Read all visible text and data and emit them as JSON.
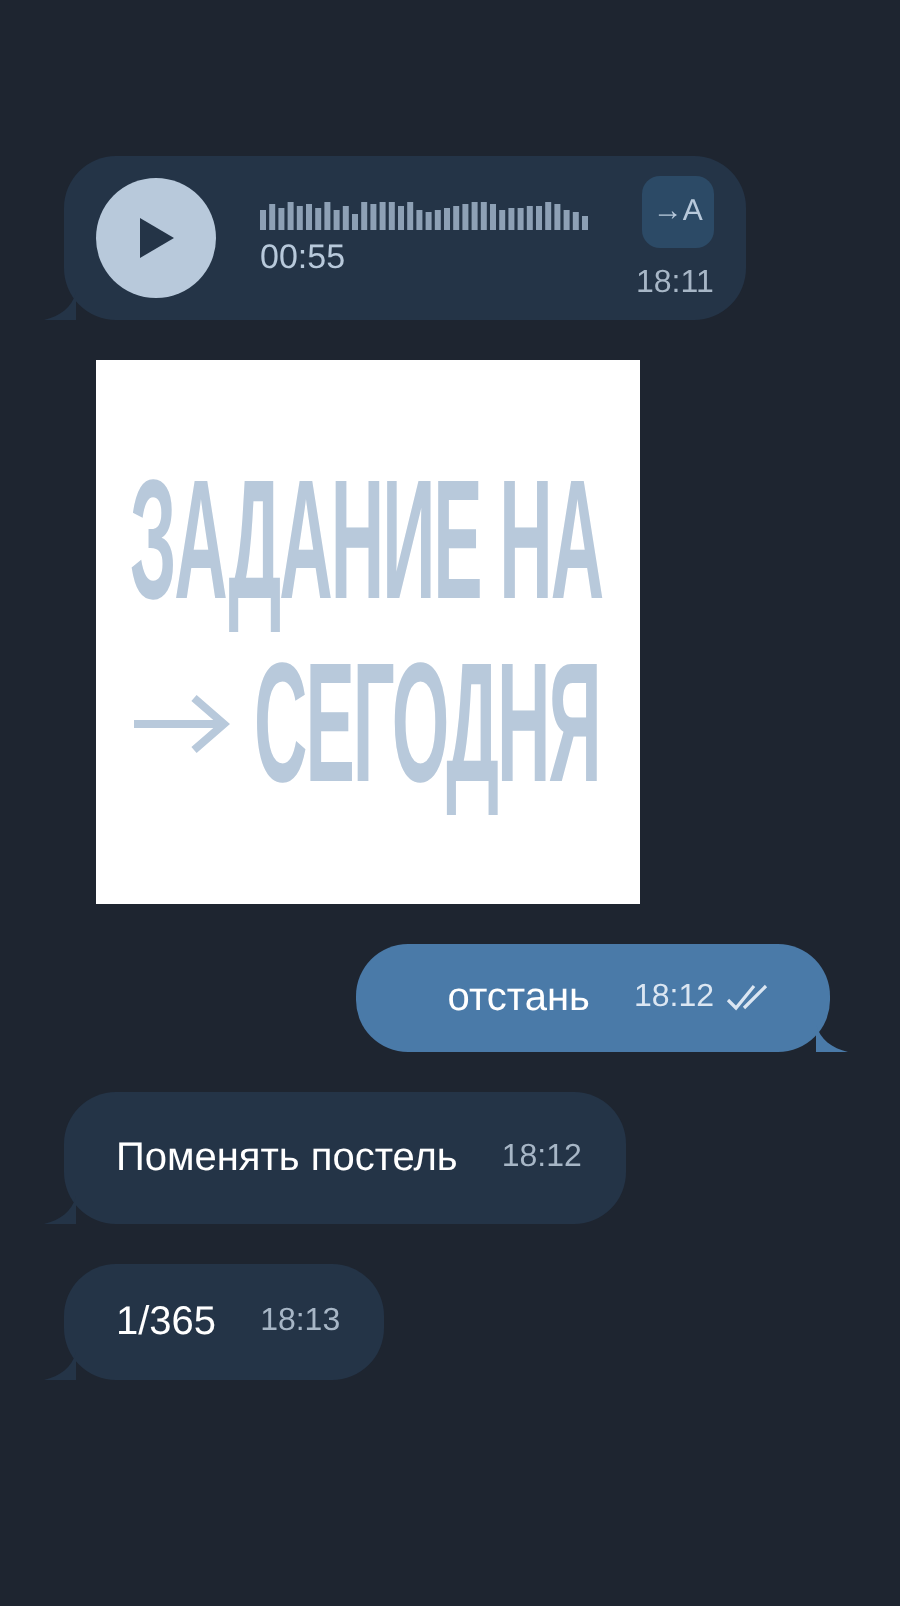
{
  "messages": [
    {
      "kind": "voice",
      "outgoing": false,
      "duration": "00:55",
      "transcribe": "→A",
      "time": "18:11"
    },
    {
      "kind": "image",
      "outgoing": false,
      "lines": [
        "ЗАДАНИЕ НА",
        "СЕГОДНЯ"
      ]
    },
    {
      "kind": "text",
      "outgoing": true,
      "text": "отстань",
      "time": "18:12",
      "read": true
    },
    {
      "kind": "text",
      "outgoing": false,
      "text": "Поменять постель",
      "time": "18:12"
    },
    {
      "kind": "text",
      "outgoing": false,
      "text": "1/365",
      "time": "18:13"
    }
  ]
}
